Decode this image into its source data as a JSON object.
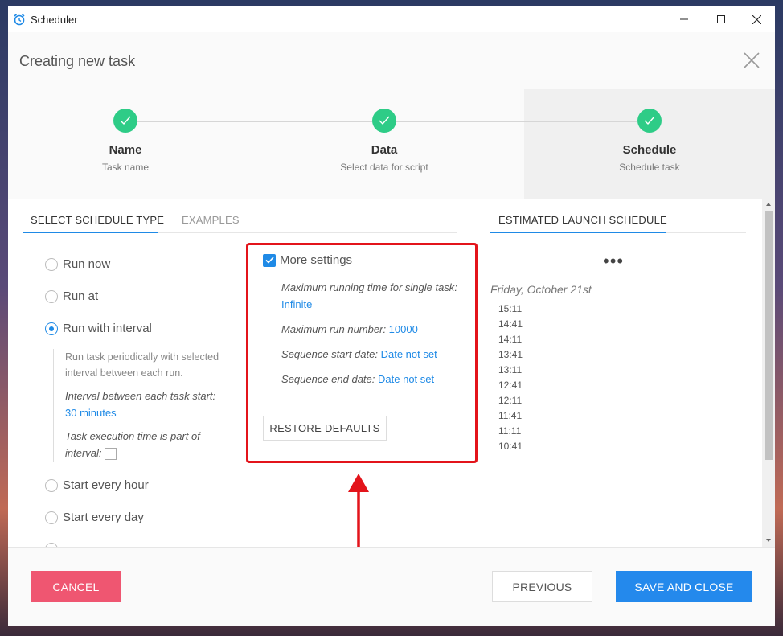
{
  "window": {
    "app_title": "Scheduler"
  },
  "header": {
    "title": "Creating new task"
  },
  "steps": [
    {
      "title": "Name",
      "subtitle": "Task name"
    },
    {
      "title": "Data",
      "subtitle": "Select data for script"
    },
    {
      "title": "Schedule",
      "subtitle": "Schedule task"
    }
  ],
  "left_tabs": {
    "select": "SELECT SCHEDULE TYPE",
    "examples": "EXAMPLES"
  },
  "schedule_types": [
    {
      "label": "Run now",
      "checked": false
    },
    {
      "label": "Run at",
      "checked": false
    },
    {
      "label": "Run with interval",
      "checked": true
    },
    {
      "label": "Start every hour",
      "checked": false
    },
    {
      "label": "Start every day",
      "checked": false
    }
  ],
  "interval": {
    "description": "Run task periodically with selected interval between each run.",
    "interval_label": "Interval between each task start",
    "interval_value": "30 minutes",
    "exec_time_label": "Task execution time is part of interval"
  },
  "more_settings": {
    "label": "More settings",
    "checked": true,
    "max_running_time_label": "Maximum running time for single task",
    "max_running_time_value": "Infinite",
    "max_run_number_label": "Maximum run number",
    "max_run_number_value": "10000",
    "seq_start_label": "Sequence start date",
    "seq_start_value": "Date not set",
    "seq_end_label": "Sequence end date",
    "seq_end_value": "Date not set",
    "restore_label": "RESTORE DEFAULTS"
  },
  "estimated": {
    "tab_label": "ESTIMATED LAUNCH SCHEDULE",
    "more": "•••",
    "date": "Friday, October 21st",
    "times": [
      "15:11",
      "14:41",
      "14:11",
      "13:41",
      "13:11",
      "12:41",
      "12:11",
      "11:41",
      "11:11",
      "10:41"
    ]
  },
  "footer": {
    "cancel": "CANCEL",
    "previous": "PREVIOUS",
    "save": "SAVE AND CLOSE"
  },
  "colors": {
    "accent": "#1f8ae6",
    "step_done": "#2ecc87",
    "cancel": "#ef5671",
    "save": "#2489ec",
    "highlight": "#e3141b"
  }
}
